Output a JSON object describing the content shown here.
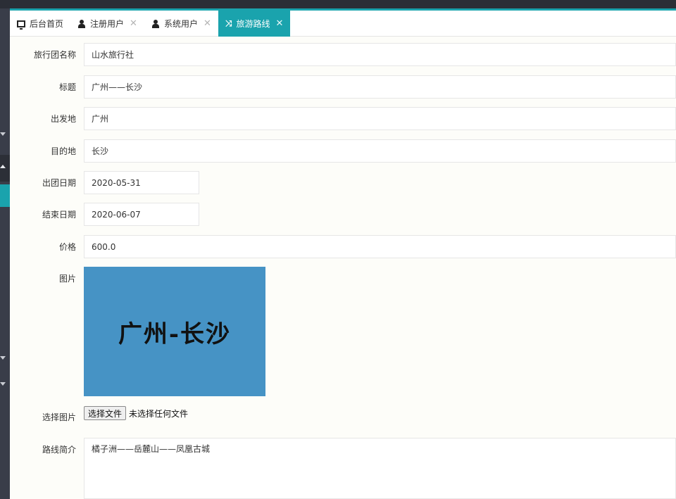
{
  "tabs": [
    {
      "label": "后台首页",
      "icon": "monitor-icon",
      "closable": false,
      "active": false
    },
    {
      "label": "注册用户",
      "icon": "user-icon",
      "closable": true,
      "active": false
    },
    {
      "label": "系统用户",
      "icon": "user-icon",
      "closable": true,
      "active": false
    },
    {
      "label": "旅游路线",
      "icon": "route-icon",
      "closable": true,
      "active": true
    }
  ],
  "close_glyph": "✕",
  "form": {
    "agency": {
      "label": "旅行团名称",
      "value": "山水旅行社"
    },
    "title": {
      "label": "标题",
      "value": "广州——长沙"
    },
    "departure": {
      "label": "出发地",
      "value": "广州"
    },
    "destination": {
      "label": "目的地",
      "value": "长沙"
    },
    "start_date": {
      "label": "出团日期",
      "value": "2020-05-31"
    },
    "end_date": {
      "label": "结束日期",
      "value": "2020-06-07"
    },
    "price": {
      "label": "价格",
      "value": "600.0"
    },
    "picture": {
      "label": "图片",
      "image_text": "广州-长沙"
    },
    "choose_picture": {
      "label": "选择图片",
      "button": "选择文件",
      "status": "未选择任何文件"
    },
    "summary": {
      "label": "路线简介",
      "value": "橘子洲——岳麓山——凤凰古城"
    }
  },
  "colors": {
    "accent": "#1aa3ad",
    "picture_bg": "#4693c5",
    "sidebar": "#393d49"
  }
}
